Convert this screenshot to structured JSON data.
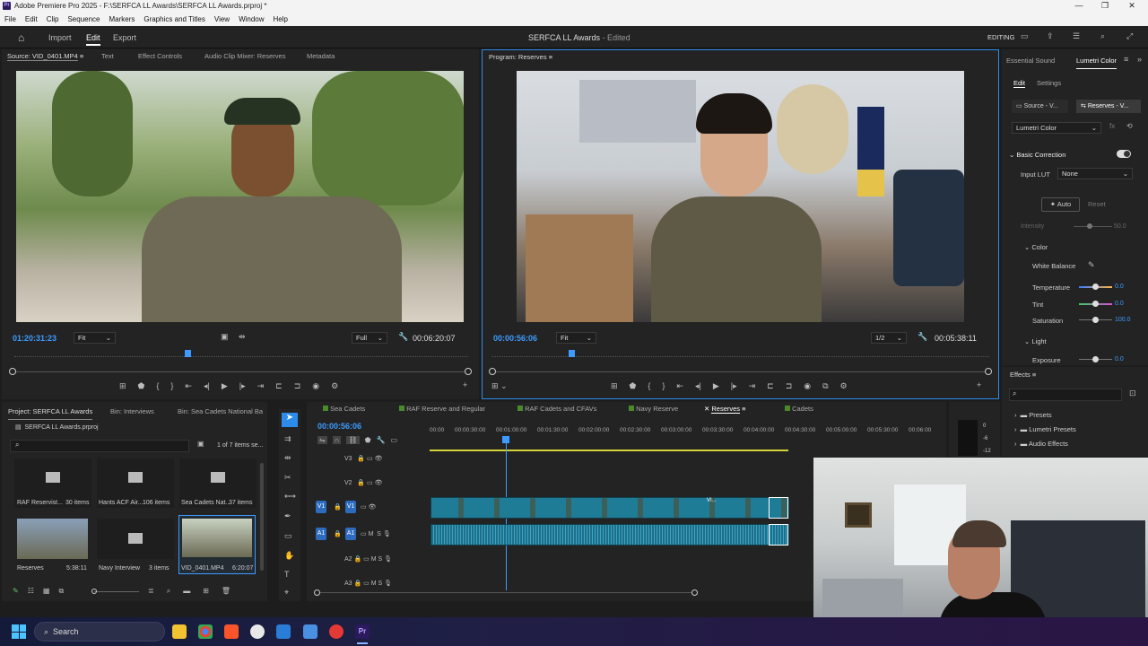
{
  "titlebar": {
    "title": "Adobe Premiere Pro 2025 - F:\\SERFCA LL Awards\\SERFCA LL Awards.prproj *"
  },
  "menu": [
    "File",
    "Edit",
    "Clip",
    "Sequence",
    "Markers",
    "Graphics and Titles",
    "View",
    "Window",
    "Help"
  ],
  "appbar": {
    "import": "Import",
    "edit": "Edit",
    "export": "Export",
    "project_title": "SERFCA LL Awards",
    "edited": "- Edited",
    "workspace": "EDITING"
  },
  "source": {
    "tabs": [
      "Source: VID_0401.MP4",
      "Text",
      "Effect Controls",
      "Audio Clip Mixer: Reserves",
      "Metadata"
    ],
    "timecode": "01:20:31:23",
    "fit": "Fit",
    "quality": "Full",
    "duration": "00:06:20:07"
  },
  "program": {
    "tab": "Program: Reserves",
    "timecode": "00:00:56:06",
    "fit": "Fit",
    "quality": "1/2",
    "duration": "00:05:38:11"
  },
  "right_panel": {
    "tabs": [
      "Essential Sound",
      "Lumetri Color"
    ],
    "subtabs": [
      "Edit",
      "Settings"
    ],
    "source_btn": "Source - V...",
    "seq_btn": "Reserves - V...",
    "effect": "Lumetri Color",
    "basic_correction": "Basic Correction",
    "input_lut_label": "Input LUT",
    "input_lut_value": "None",
    "auto": "Auto",
    "reset": "Reset",
    "intensity_label": "Intensity",
    "intensity_value": "50.0",
    "color_section": "Color",
    "white_balance": "White Balance",
    "temperature_label": "Temperature",
    "temperature_value": "0.0",
    "tint_label": "Tint",
    "tint_value": "0.0",
    "saturation_label": "Saturation",
    "saturation_value": "100.0",
    "light_section": "Light",
    "exposure_label": "Exposure",
    "exposure_value": "0.0"
  },
  "effects": {
    "title": "Effects",
    "items": [
      "Presets",
      "Lumetri Presets",
      "Audio Effects"
    ]
  },
  "project": {
    "tabs": [
      "Project: SERFCA LL Awards",
      "Bin: Interviews",
      "Bin: Sea Cadets National Ba"
    ],
    "file": "SERFCA LL Awards.prproj",
    "selection": "1 of 7 items se...",
    "items": [
      {
        "name": "RAF Reservist...",
        "meta": "30 items"
      },
      {
        "name": "Hants ACF Air...",
        "meta": "106 items"
      },
      {
        "name": "Sea Cadets Nat...",
        "meta": "37 items"
      },
      {
        "name": "Reserves",
        "meta": "5:38:11"
      },
      {
        "name": "Navy Interview",
        "meta": "3 items"
      },
      {
        "name": "VID_0401.MP4",
        "meta": "6:20:07"
      }
    ]
  },
  "timeline": {
    "tabs": [
      "Sea Cadets",
      "RAF Reserve and Regular",
      "RAF Cadets and CFAVs",
      "Navy Reserve",
      "Reserves",
      "Cadets"
    ],
    "active_tab": "Reserves",
    "timecode": "00:00:56:06",
    "ruler": [
      "00:00",
      "00:00:30:00",
      "00:01:00:00",
      "00:01:30:00",
      "00:02:00:00",
      "00:02:30:00",
      "00:03:00:00",
      "00:03:30:00",
      "00:04:00:00",
      "00:04:30:00",
      "00:05:00:00",
      "00:05:30:00",
      "00:06:00"
    ],
    "tracks": [
      {
        "name": "V3",
        "type": "video"
      },
      {
        "name": "V2",
        "type": "video"
      },
      {
        "name": "V1",
        "type": "video"
      },
      {
        "name": "A1",
        "type": "audio"
      },
      {
        "name": "A2",
        "type": "audio"
      },
      {
        "name": "A3",
        "type": "audio"
      }
    ],
    "clip_label": "VI...",
    "m": "M",
    "s": "S"
  },
  "meter": {
    "labels": [
      "0",
      "-6",
      "-12"
    ]
  },
  "taskbar": {
    "search": "Search"
  },
  "colors": {
    "accent": "#2d8ceb",
    "clip_video": "#1f7c97",
    "timecode": "#3d9bff"
  }
}
